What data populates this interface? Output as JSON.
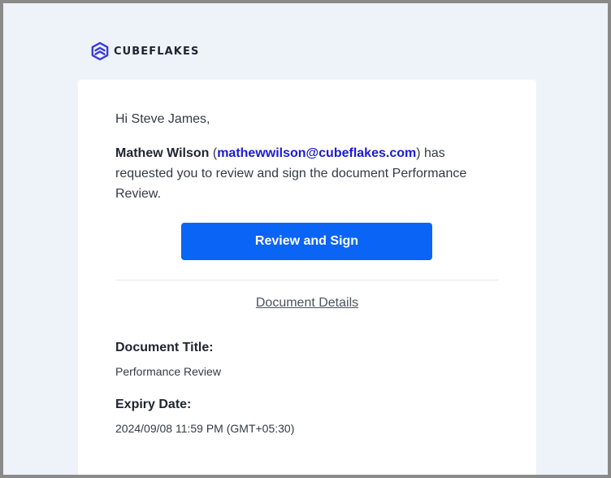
{
  "brand": {
    "name": "CUBEFLAKES",
    "icon": "cube-logo-icon",
    "color": "#3b3bd8"
  },
  "email": {
    "greeting": "Hi Steve James,",
    "sender_name": "Mathew Wilson",
    "open_paren": " (",
    "sender_email": "mathewwilson@cubeflakes.com",
    "message_rest": ") has requested you to review and sign the document Performance Review.",
    "cta_label": "Review and Sign",
    "cta_color": "#0a64f5",
    "details_link": "Document Details"
  },
  "document": {
    "title_label": "Document Title:",
    "title_value": "Performance Review",
    "expiry_label": "Expiry Date:",
    "expiry_value": "2024/09/08 11:59 PM (GMT+05:30)"
  }
}
